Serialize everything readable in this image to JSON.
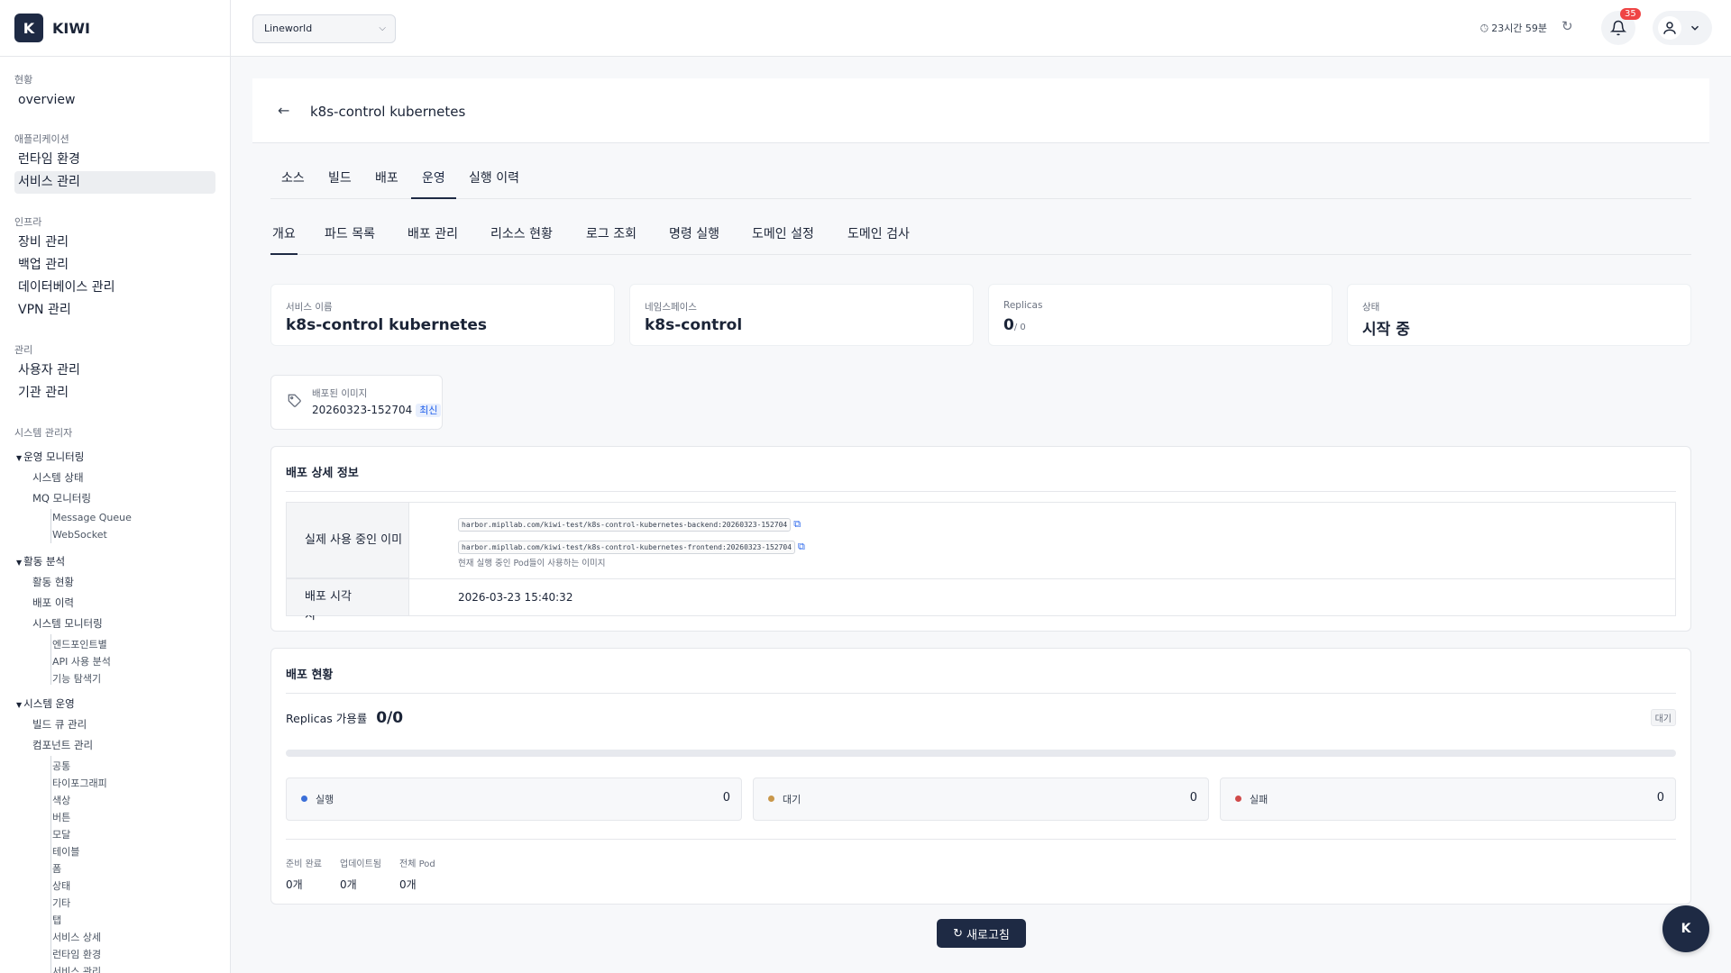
{
  "app": {
    "logo_letter": "K",
    "name": "KIWI"
  },
  "sidebar": {
    "sec_status": "현황",
    "overview": "overview",
    "sec_app": "애플리케이션",
    "runtime": "런타임 환경",
    "service_mgmt": "서비스 관리",
    "sec_infra": "인프라",
    "device_mgmt": "장비 관리",
    "backup_mgmt": "백업 관리",
    "db_mgmt": "데이터베이스 관리",
    "vpn_mgmt": "VPN 관리",
    "sec_manage": "관리",
    "user_mgmt": "사용자 관리",
    "org_mgmt": "기관 관리",
    "sec_sysadmin": "시스템 관리자",
    "g_ops_monitor": "운영 모니터링",
    "system_status": "시스템 상태",
    "mq_monitor": "MQ 모니터링",
    "message_queue": "Message Queue",
    "websocket": "WebSocket",
    "g_activity": "활동 분석",
    "activity_status": "활동 현황",
    "deploy_history": "배포 이력",
    "system_monitoring": "시스템 모니터링",
    "by_endpoint": "엔드포인트별",
    "api_usage": "API 사용 분석",
    "feature_explorer": "기능 탐색기",
    "g_sys_ops": "시스템 운영",
    "build_queue": "빌드 큐 관리",
    "component_mgmt": "컴포넌트 관리",
    "c_common": "공통",
    "c_typography": "타이포그래피",
    "c_color": "색상",
    "c_button": "버튼",
    "c_modal": "모달",
    "c_table": "테이블",
    "c_form": "폼",
    "c_state": "상태",
    "c_etc": "기타",
    "c_tab": "탭",
    "c_service_detail": "서비스 상세",
    "c_runtime": "런타임 환경",
    "c_service_mgmt": "서비스 관리"
  },
  "topbar": {
    "workspace": "Lineworld",
    "timer": "23시간 59분",
    "notif_count": "35"
  },
  "page": {
    "title": "k8s-control kubernetes",
    "tabs": [
      "소스",
      "빌드",
      "배포",
      "운영",
      "실행 이력"
    ],
    "subtabs": [
      "개요",
      "파드 목록",
      "배포 관리",
      "리소스 현황",
      "로그 조회",
      "명령 실행",
      "도메인 설정",
      "도메인 검사"
    ]
  },
  "stats": {
    "service_name_label": "서비스 이름",
    "service_name": "k8s-control kubernetes",
    "namespace_label": "네임스페이스",
    "namespace": "k8s-control",
    "replicas_label": "Replicas",
    "replicas": "0",
    "replicas_total": "/ 0",
    "status_label": "상태",
    "status": "시작 중"
  },
  "image": {
    "label": "배포된 이미지",
    "tag": "20260323-152704",
    "latest": "최신"
  },
  "deploy_detail": {
    "title": "배포 상세 정보",
    "images_label": "실제 사용 중인 이미지",
    "image_backend": "harbor.mipllab.com/kiwi-test/k8s-control-kubernetes-backend:20260323-152704",
    "image_frontend": "harbor.mipllab.com/kiwi-test/k8s-control-kubernetes-frontend:20260323-152704",
    "images_note": "현재 실행 중인 Pod들이 사용하는 이미지",
    "time_label": "배포 시각",
    "time": "2026-03-23 15:40:32"
  },
  "deploy_status": {
    "title": "배포 현황",
    "ratio_label": "Replicas 가용률",
    "ratio": "0/0",
    "badge": "대기",
    "progress_fraction": 0,
    "running_label": "실행",
    "running": "0",
    "pending_label": "대기",
    "pending": "0",
    "failed_label": "실패",
    "failed": "0",
    "ready_label": "준비 완료",
    "ready": "0개",
    "updated_label": "업데이트됨",
    "updated": "0개",
    "total_label": "전체 Pod",
    "total": "0개",
    "colors": {
      "running": "#3b6fd8",
      "pending": "#c9974a",
      "failed": "#d04a4a"
    }
  },
  "actions": {
    "refresh": "새로고침",
    "fab_letter": "K"
  }
}
